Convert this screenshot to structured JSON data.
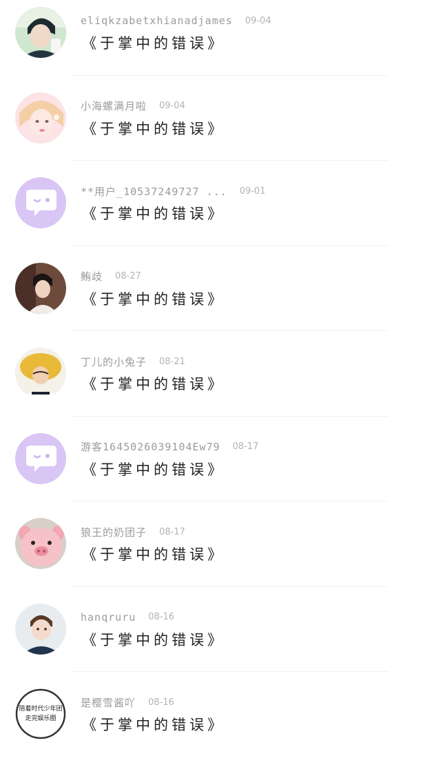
{
  "comments": [
    {
      "avatar_icon": "user-avatar-icon",
      "username": "eliqkzabetxhianadjames",
      "date": "09-04",
      "text": "《于掌中的错误》"
    },
    {
      "avatar_icon": "user-avatar-icon",
      "username": "小海螺满月啦",
      "date": "09-04",
      "text": "《于掌中的错误》"
    },
    {
      "avatar_icon": "default-chat-avatar-icon",
      "username": "**用户_10537249727 ...",
      "date": "09-01",
      "text": "《于掌中的错误》"
    },
    {
      "avatar_icon": "user-avatar-icon",
      "username": "鲔歧",
      "date": "08-27",
      "text": "《于掌中的错误》"
    },
    {
      "avatar_icon": "user-avatar-icon",
      "username": "丁儿的小兔子",
      "date": "08-21",
      "text": "《于掌中的错误》"
    },
    {
      "avatar_icon": "default-chat-avatar-icon",
      "username": "游客1645026039104Ew79",
      "date": "08-17",
      "text": "《于掌中的错误》"
    },
    {
      "avatar_icon": "pig-avatar-icon",
      "username": "狼王的奶团子",
      "date": "08-17",
      "text": "《于掌中的错误》"
    },
    {
      "avatar_icon": "user-avatar-icon",
      "username": "hanqruru",
      "date": "08-16",
      "text": "《于掌中的错误》"
    },
    {
      "avatar_icon": "text-badge-avatar-icon",
      "username": "是樱雪酱吖",
      "date": "08-16",
      "text": "《于掌中的错误》"
    }
  ],
  "avatar_badge_text": "陪着时代少年团走完娱乐圈",
  "colors": {
    "default_avatar_bg": "#d9c6f5",
    "username": "#9b9b9b",
    "date": "#b3b3b3",
    "comment": "#222222",
    "divider": "#f0f0f0"
  }
}
